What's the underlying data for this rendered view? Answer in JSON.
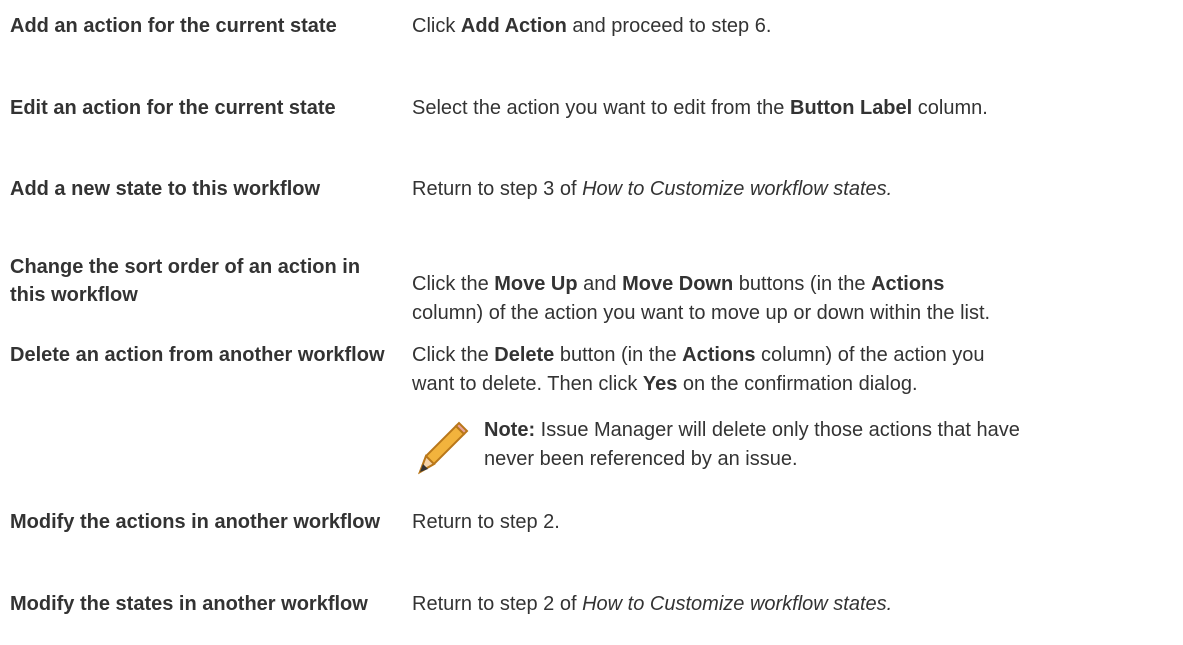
{
  "rows": [
    {
      "task": "Add an action for the current state",
      "action": [
        {
          "t": "Click "
        },
        {
          "b": "Add Action"
        },
        {
          "t": " and proceed to step 6."
        }
      ]
    },
    {
      "task": "Edit an action for the current state",
      "action": [
        {
          "t": "Select the action you want to edit from the "
        },
        {
          "b": "Button Label"
        },
        {
          "t": " column."
        }
      ]
    },
    {
      "task": "Add a new state to this workflow",
      "action": [
        {
          "t": "Return to step 3 of "
        },
        {
          "i": "How to Customize workflow states."
        }
      ]
    },
    {
      "task": "Change the sort order of an action in this workflow",
      "action": [
        {
          "t": "Click the "
        },
        {
          "b": "Move Up"
        },
        {
          "t": " and "
        },
        {
          "b": "Move Down"
        },
        {
          "t": " buttons (in the "
        },
        {
          "b": "Actions"
        },
        {
          "br": true
        },
        {
          "t": "column) of the action you want to move up or down within the list."
        }
      ]
    },
    {
      "task": "Delete an action from another workflow",
      "action": [
        {
          "t": "Click the "
        },
        {
          "b": "Delete"
        },
        {
          "t": " button (in the "
        },
        {
          "b": "Actions"
        },
        {
          "t": " column) of the action you"
        },
        {
          "br": true
        },
        {
          "t": "want to delete. Then click "
        },
        {
          "b": "Yes"
        },
        {
          "t": " on the confirmation dialog."
        }
      ],
      "note": {
        "label": "Note:",
        "line1": " Issue Manager will delete only those actions that have",
        "line2": "never been referenced by an issue."
      }
    },
    {
      "task": "Modify the actions in another workflow",
      "action": [
        {
          "t": "Return to step 2."
        }
      ]
    },
    {
      "task": "Modify the states in another workflow",
      "action": [
        {
          "t": "Return to step 2 of "
        },
        {
          "i": "How to Customize workflow states."
        }
      ]
    }
  ]
}
